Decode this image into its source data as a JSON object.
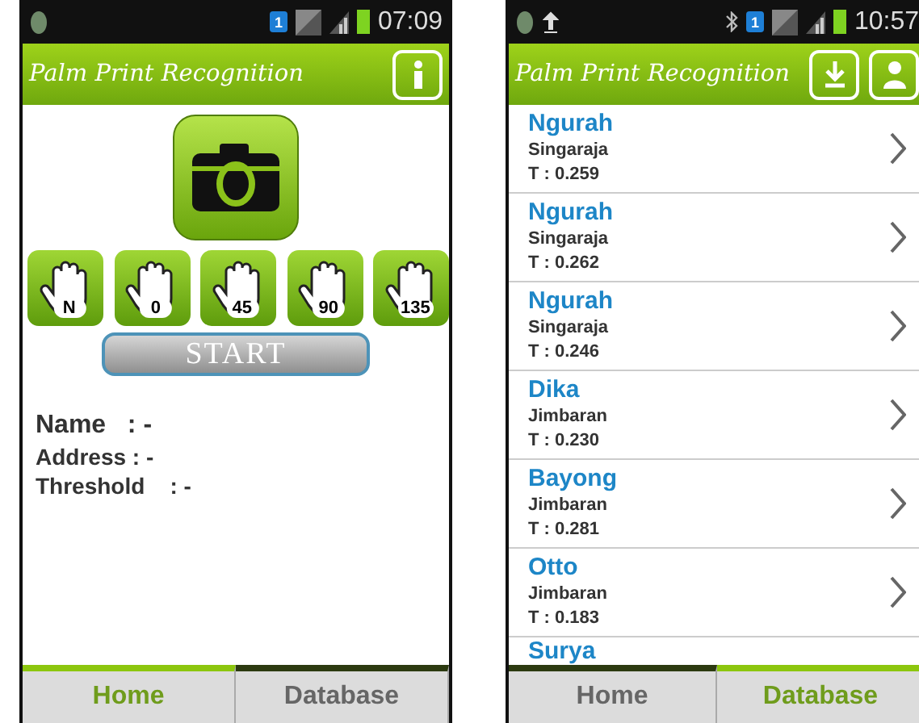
{
  "screens": [
    {
      "status_bar": {
        "time": "07:09",
        "upload": false,
        "bluetooth": false,
        "sim": "1"
      },
      "app_title": "Palm Print Recognition",
      "header_actions": [
        {
          "kind": "info"
        }
      ],
      "kind": "home",
      "capture": {
        "angles": [
          "N",
          "0",
          "45",
          "90",
          "135"
        ],
        "start": "START"
      },
      "fields": [
        {
          "label": "Name",
          "value": ": -"
        },
        {
          "label": "Address",
          "value": ": -"
        },
        {
          "label": "Threshold",
          "value": ": -"
        }
      ],
      "tabs": [
        {
          "label": "Home",
          "selected": true
        },
        {
          "label": "Database",
          "selected": false
        }
      ]
    },
    {
      "status_bar": {
        "time": "10:57",
        "upload": true,
        "bluetooth": true,
        "sim": "1"
      },
      "app_title": "Palm Print Recognition",
      "header_actions": [
        {
          "kind": "download"
        },
        {
          "kind": "person"
        }
      ],
      "kind": "database",
      "records": [
        {
          "name": "Ngurah",
          "address": "Singaraja",
          "threshold": "T : 0.259"
        },
        {
          "name": "Ngurah",
          "address": "Singaraja",
          "threshold": "T : 0.262"
        },
        {
          "name": "Ngurah",
          "address": "Singaraja",
          "threshold": "T : 0.246"
        },
        {
          "name": "Dika",
          "address": "Jimbaran",
          "threshold": "T : 0.230"
        },
        {
          "name": "Bayong",
          "address": "Jimbaran",
          "threshold": "T : 0.281"
        },
        {
          "name": "Otto",
          "address": "Jimbaran",
          "threshold": "T : 0.183"
        },
        {
          "name": "Surya"
        }
      ],
      "tabs": [
        {
          "label": "Home",
          "selected": false
        },
        {
          "label": "Database",
          "selected": true
        }
      ]
    }
  ]
}
